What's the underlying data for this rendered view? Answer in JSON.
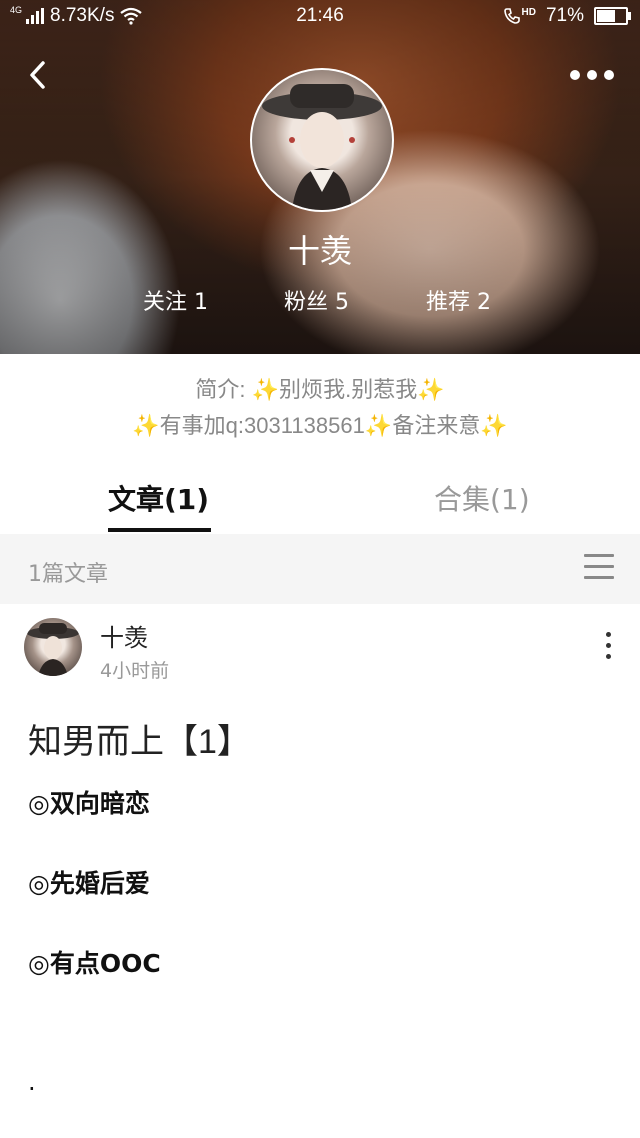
{
  "status_bar": {
    "network": "4G",
    "speed": "8.73K/s",
    "time": "21:46",
    "call_badge": "HD",
    "battery": "71%",
    "battery_level": 0.71
  },
  "profile": {
    "nickname": "十羡",
    "stats": {
      "follow": "关注 1",
      "fans": "粉丝 5",
      "recommend": "推荐 2"
    },
    "bio_line1": "简介: ✨别烦我.别惹我✨",
    "bio_line2": "✨有事加q:3031138561✨备注来意✨"
  },
  "tabs": {
    "articles": "文章(1)",
    "collections": "合集(1)"
  },
  "section": {
    "count": "1篇文章"
  },
  "post": {
    "author": "十羡",
    "time": "4小时前",
    "title": "知男而上【1】",
    "lines": [
      "◎双向暗恋",
      "◎先婚后爱",
      "◎有点OOC"
    ],
    "trailing": "."
  },
  "icons": {
    "back": "back-arrow-icon",
    "more": "more-dots-icon",
    "list": "list-menu-icon",
    "post_menu": "vertical-dots-icon"
  }
}
